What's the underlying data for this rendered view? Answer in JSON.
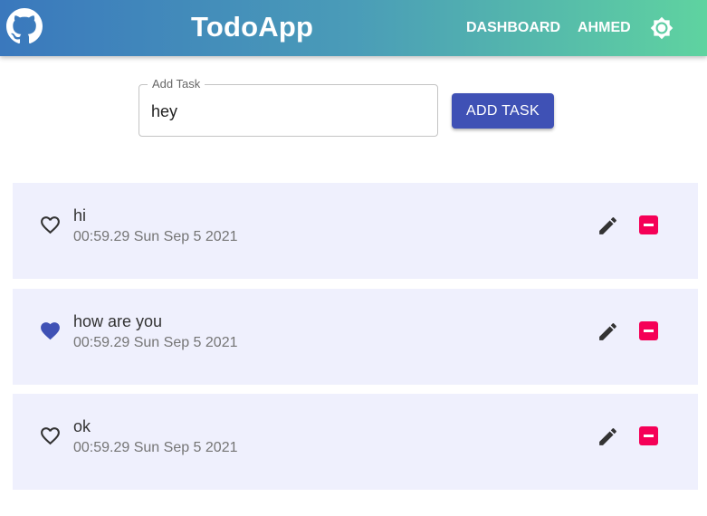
{
  "header": {
    "title": "TodoApp",
    "nav": {
      "dashboard": "DASHBOARD",
      "user": "AHMED"
    },
    "logo_icon": "github-icon",
    "theme_icon": "brightness-icon"
  },
  "form": {
    "label": "Add Task",
    "value": "hey",
    "button_label": "ADD TASK"
  },
  "tasks": [
    {
      "title": "hi",
      "timestamp": "00:59.29 Sun Sep 5 2021",
      "favorite": false
    },
    {
      "title": "how are you",
      "timestamp": "00:59.29 Sun Sep 5 2021",
      "favorite": true
    },
    {
      "title": "ok",
      "timestamp": "00:59.29 Sun Sep 5 2021",
      "favorite": false
    }
  ],
  "colors": {
    "primary": "#3f51b5",
    "delete": "#f50057",
    "task_bg": "#eff0fd",
    "gradient_start": "#3a78bd",
    "gradient_end": "#5fd3a0"
  }
}
